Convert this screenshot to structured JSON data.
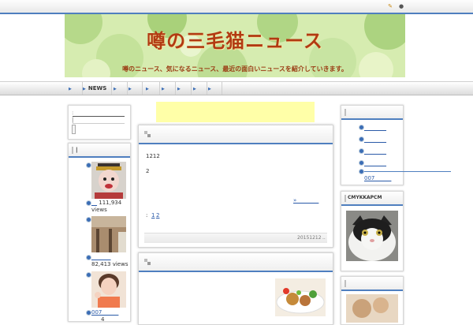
{
  "header": {
    "icons": [
      "pencil-icon",
      "user-icon"
    ],
    "title": "噂の三毛猫ニュース",
    "subtitle": "噂のニュース、気になるニュース、最近の面白いニュースを紹介していきます。"
  },
  "nav": {
    "items": [
      "",
      "NEWS",
      "",
      "",
      "",
      "",
      "",
      "",
      ""
    ]
  },
  "left_sidebar": {
    "search": {
      "line1": ":",
      "line2": "|",
      "button": "|"
    },
    "popular": {
      "label": "|",
      "items": [
        {
          "title": "__",
          "views": "111,934 views"
        },
        {
          "title": "_______",
          "views": "82,413 views"
        },
        {
          "title": "007______",
          "views": "4"
        }
      ]
    }
  },
  "main": {
    "post1": {
      "body_line1": "1212",
      "body_line2": "2",
      "more_link": "»________",
      "pager_label": ":",
      "pages": [
        "1",
        "2"
      ],
      "date": "20151212",
      "meta": ".."
    },
    "post2": {}
  },
  "right_sidebar": {
    "links": {
      "items": [
        "________",
        "________",
        "________",
        "________",
        "007______"
      ]
    },
    "cat_box": {
      "label": "CMYKKAPCM"
    },
    "third_box": {
      "label": ""
    }
  },
  "colors": {
    "accent": "#4f7fbf",
    "link": "#2a5aa8",
    "title": "#b23a12",
    "ad_bg": "#ffffa8",
    "banner_bg": "#cfe7a8"
  }
}
